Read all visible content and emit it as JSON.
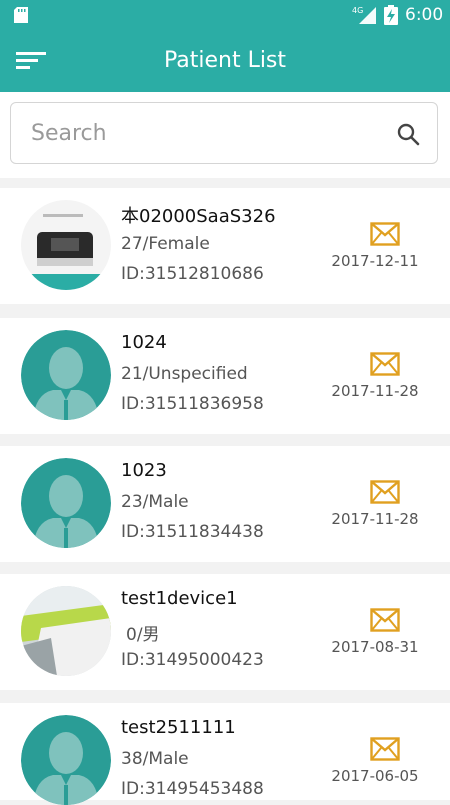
{
  "status_bar": {
    "network": "4G",
    "time": "6:00"
  },
  "header": {
    "title": "Patient List"
  },
  "search": {
    "placeholder": "Search"
  },
  "colors": {
    "accent": "#2bada5",
    "mail": "#e0a020"
  },
  "patients": [
    {
      "name": "本02000SaaS326",
      "age_sex": "27/Female",
      "id": "ID:31512810686",
      "date": "2017-12-11",
      "avatar": "device-photo"
    },
    {
      "name": "1024",
      "age_sex": "21/Unspecified",
      "id": "ID:31511836958",
      "date": "2017-11-28",
      "avatar": "default-person"
    },
    {
      "name": "1023",
      "age_sex": "23/Male",
      "id": "ID:31511834438",
      "date": "2017-11-28",
      "avatar": "default-person"
    },
    {
      "name": "test1device1",
      "age_sex": "0/男",
      "id": "ID:31495000423",
      "date": "2017-08-31",
      "avatar": "photo"
    },
    {
      "name": "test2511111",
      "age_sex": "38/Male",
      "id": "ID:31495453488",
      "date": "2017-06-05",
      "avatar": "default-person"
    }
  ]
}
